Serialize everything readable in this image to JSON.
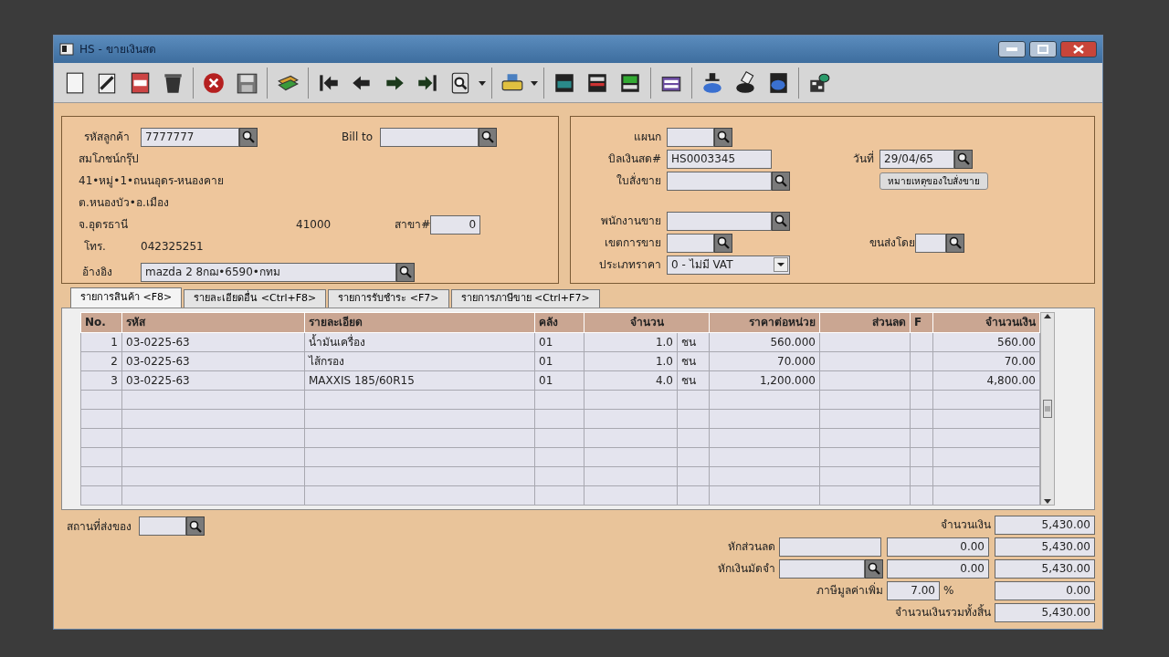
{
  "window": {
    "title": "HS - ขายเงินสด"
  },
  "customer": {
    "code_label": "รหัสลูกค้า",
    "code": "7777777",
    "bill_to_label": "Bill to",
    "name": "สมโภชน์กรุ๊ป",
    "address": [
      "41•หมู่•1•ถนนอุดร-หนองคาย",
      "ต.หนองบัว•อ.เมือง",
      "จ.อุดรธานี"
    ],
    "postcode": "41000",
    "branch_label": "สาขา#",
    "branch": "0",
    "phone_label": "โทร.",
    "phone": "042325251",
    "reference_label": "อ้างอิง",
    "reference": "mazda 2 8กฌ•6590•กทม"
  },
  "document": {
    "department_label": "แผนก",
    "bill_no_label": "บิลเงินสด#",
    "bill_no": "HS0003345",
    "date_label": "วันที่",
    "date": "29/04/65",
    "sales_order_label": "ใบสั่งขาย",
    "sales_order_note_button": "หมายเหตุของใบสั่งขาย",
    "salesperson_label": "พนักงานขาย",
    "sales_area_label": "เขตการขาย",
    "shipping_label": "ขนส่งโดย",
    "price_type_label": "ประเภทราคา",
    "price_type": "0 - ไม่มี VAT"
  },
  "tabs": [
    {
      "label": "รายการสินค้า <F8>",
      "selected": true
    },
    {
      "label": "รายละเอียดอื่น <Ctrl+F8>",
      "selected": false
    },
    {
      "label": "รายการรับชำระ <F7>",
      "selected": false
    },
    {
      "label": "รายการภาษีขาย <Ctrl+F7>",
      "selected": false
    }
  ],
  "table": {
    "columns": [
      "No.",
      "รหัส",
      "รายละเอียด",
      "คลัง",
      "จำนวน",
      "ราคาต่อหน่วย",
      "ส่วนลด",
      "F",
      "จำนวนเงิน"
    ],
    "rows": [
      {
        "no": "1",
        "code": "03-0225-63",
        "description": "น้ำมันเครื่อง",
        "warehouse": "01",
        "quantity": "1.0",
        "unit": "ชน",
        "unit_price": "560.000",
        "amount": "560.00"
      },
      {
        "no": "2",
        "code": "03-0225-63",
        "description": "ไส้กรอง",
        "warehouse": "01",
        "quantity": "1.0",
        "unit": "ชน",
        "unit_price": "70.000",
        "amount": "70.00"
      },
      {
        "no": "3",
        "code": "03-0225-63",
        "description": "MAXXIS 185/60R15",
        "warehouse": "01",
        "quantity": "4.0",
        "unit": "ชน",
        "unit_price": "1,200.000",
        "amount": "4,800.00"
      }
    ]
  },
  "footer": {
    "delivery_place_label": "สถานที่ส่งของ",
    "totals": [
      {
        "kind": "total",
        "label": "จำนวนเงิน",
        "total": "5,430.00"
      },
      {
        "kind": "discount",
        "label": "หักส่วนลด",
        "amount": "0.00",
        "total": "5,430.00"
      },
      {
        "kind": "deposit",
        "label": "หักเงินมัดจำ",
        "amount": "0.00",
        "total": "5,430.00"
      },
      {
        "kind": "vat",
        "label": "ภาษีมูลค่าเพิ่ม",
        "rate": "7.00",
        "unit": "%",
        "total": "0.00"
      },
      {
        "kind": "grand_total",
        "label": "จำนวนเงินรวมทั้งสิ้น",
        "total": "5,430.00"
      }
    ]
  }
}
